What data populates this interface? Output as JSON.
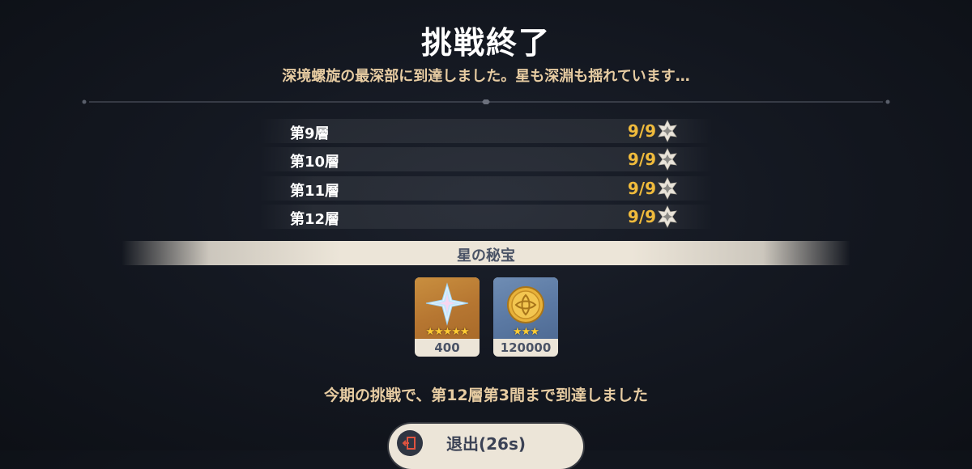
{
  "header": {
    "title": "挑戦終了",
    "subtitle": "深境螺旋の最深部に到達しました。星も深淵も揺れています…"
  },
  "floors": [
    {
      "name": "第9層",
      "stars": "9/9",
      "icon": "abyss-star-icon"
    },
    {
      "name": "第10層",
      "stars": "9/9",
      "icon": "abyss-star-icon"
    },
    {
      "name": "第11層",
      "stars": "9/9",
      "icon": "abyss-star-icon"
    },
    {
      "name": "第12層",
      "stars": "9/9",
      "icon": "abyss-star-icon"
    }
  ],
  "rewards": {
    "banner_label": "星の秘宝",
    "items": [
      {
        "icon": "primogem-icon",
        "rarity": 5,
        "rarity_text": "★★★★★",
        "count": "400"
      },
      {
        "icon": "mora-coin-icon",
        "rarity": 3,
        "rarity_text": "★★★",
        "count": "120000"
      }
    ]
  },
  "result_text": "今期の挑戦で、第12層第3間まで到達しました",
  "exit_button": {
    "label": "退出(26s)",
    "icon": "exit-door-icon"
  },
  "colors": {
    "accent_gold": "#f0bb3c",
    "subtitle_tan": "#e7cca2",
    "banner_cream": "#ece5d8",
    "background": "#141821"
  }
}
